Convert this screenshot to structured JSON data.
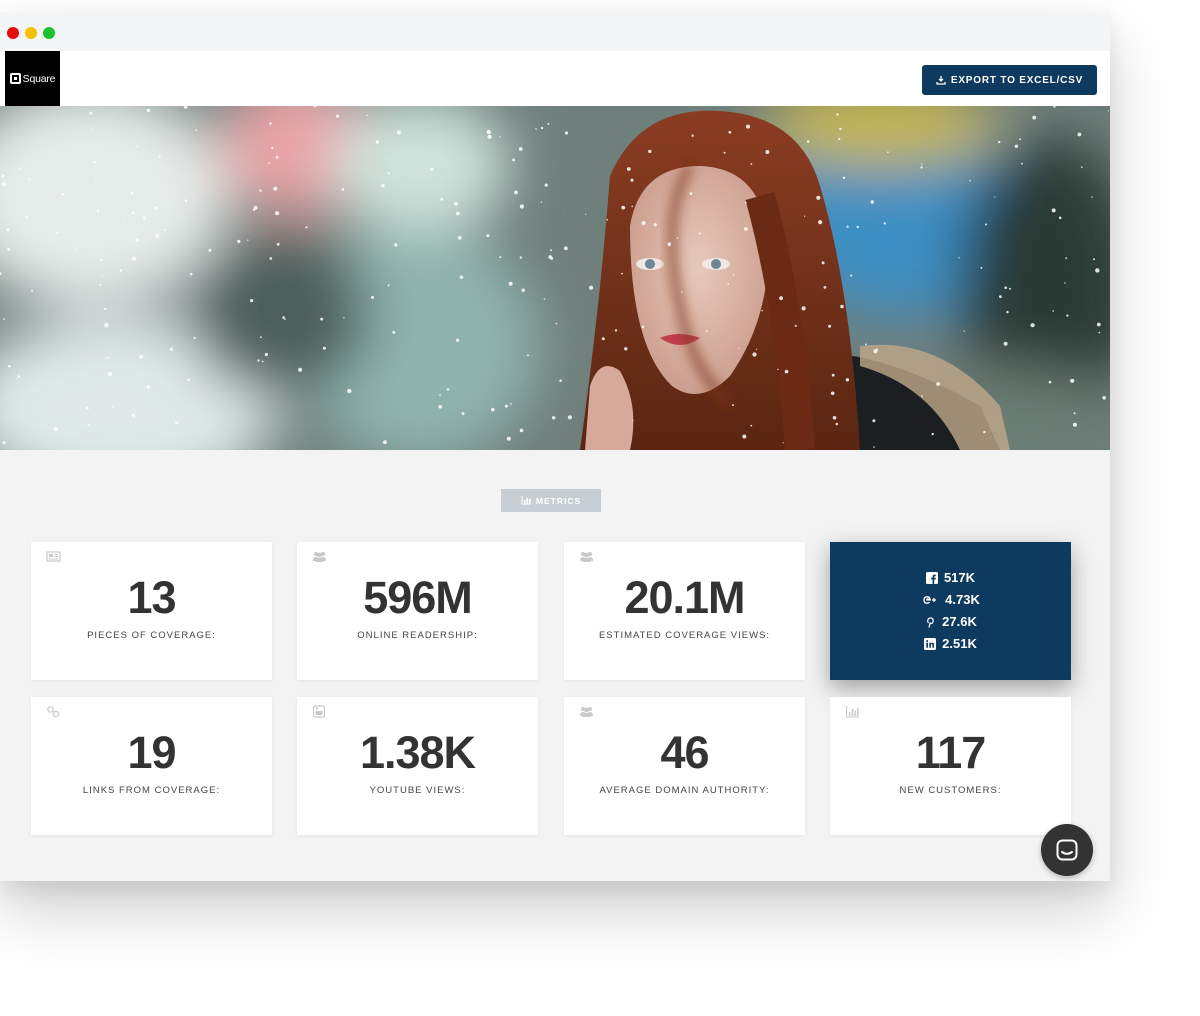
{
  "window": {
    "traffic_lights": [
      "close",
      "minimize",
      "maximize"
    ]
  },
  "header": {
    "logo_text": "Square",
    "export_label": "EXPORT TO EXCEL/CSV"
  },
  "hero": {
    "image_description_icon": "portrait-photo"
  },
  "metrics": {
    "tab_label": "METRICS",
    "cards": [
      {
        "value": "13",
        "label": "PIECES OF COVERAGE:",
        "icon": "newspaper-icon"
      },
      {
        "value": "596M",
        "label": "ONLINE READERSHIP:",
        "icon": "users-icon"
      },
      {
        "value": "20.1M",
        "label": "ESTIMATED COVERAGE VIEWS:",
        "icon": "users-icon"
      },
      {
        "value": "19",
        "label": "LINKS FROM COVERAGE:",
        "icon": "link-icon"
      },
      {
        "value": "1.38K",
        "label": "YOUTUBE VIEWS:",
        "icon": "youtube-icon"
      },
      {
        "value": "46",
        "label": "AVERAGE DOMAIN AUTHORITY:",
        "icon": "users-icon"
      },
      {
        "value": "117",
        "label": "NEW CUSTOMERS:",
        "icon": "bar-chart-icon"
      }
    ],
    "social": [
      {
        "network": "facebook-icon",
        "value": "517K"
      },
      {
        "network": "google-plus-icon",
        "value": "4.73K"
      },
      {
        "network": "pinterest-icon",
        "value": "27.6K"
      },
      {
        "network": "linkedin-icon",
        "value": "2.51K"
      }
    ]
  },
  "colors": {
    "brand_navy": "#0d3a5e",
    "background": "#f3f3f3",
    "card": "#ffffff",
    "tab_gray": "#c7cfd5"
  }
}
